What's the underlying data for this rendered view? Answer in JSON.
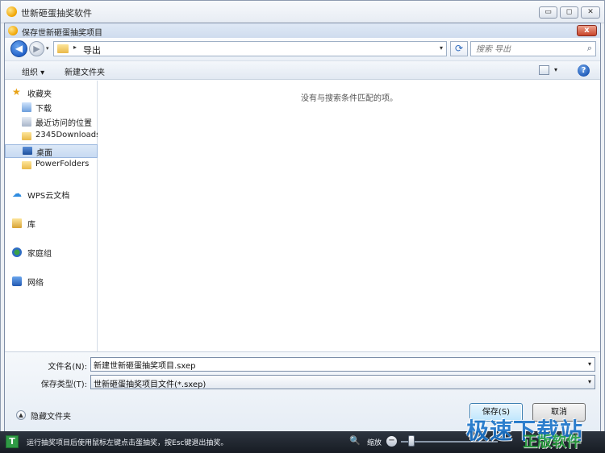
{
  "app": {
    "title": "世新砸蛋抽奖软件"
  },
  "window_controls": {
    "minimize": "▭",
    "maximize": "◻",
    "close": "✕"
  },
  "dialog": {
    "title": "保存世新砸蛋抽奖项目",
    "close_glyph": "x"
  },
  "address": {
    "back_glyph": "◀",
    "forward_glyph": "▶",
    "breadcrumb_sep": "▸",
    "current_folder": "导出",
    "dropdown_glyph": "▾",
    "refresh_glyph": "⟳",
    "search_placeholder": "搜索 导出",
    "search_glyph": "⌕"
  },
  "toolbar": {
    "organize": "组织 ▾",
    "new_folder": "新建文件夹",
    "view_drop": "▾",
    "help": "?"
  },
  "nav": {
    "favorites": "收藏夹",
    "downloads": "下载",
    "recent": "最近访问的位置",
    "folder_2345": "2345Downloads",
    "desktop": "桌面",
    "powerfolders": "PowerFolders",
    "wps_cloud": "WPS云文档",
    "library": "库",
    "homegroup": "家庭组",
    "network": "网络"
  },
  "file_list": {
    "empty_message": "没有与搜索条件匹配的项。"
  },
  "form": {
    "filename_label": "文件名(N):",
    "filename_value": "新建世新砸蛋抽奖项目.sxep",
    "filetype_label": "保存类型(T):",
    "filetype_value": "世新砸蛋抽奖项目文件(*.sxep)",
    "hide_folders": "隐藏文件夹",
    "hide_arrow": "▲",
    "save_button": "保存(S)",
    "cancel_button": "取消"
  },
  "statusbar": {
    "icon_letter": "T",
    "message": "运行抽奖项目后使用鼠标左键点击蛋抽奖，按Esc键退出抽奖。",
    "zoom_glyph": "🔍",
    "zoom_label": "缩放",
    "zoom_minus": "−"
  },
  "watermark": {
    "top": "极速下载站",
    "bottom": "正版软件"
  }
}
